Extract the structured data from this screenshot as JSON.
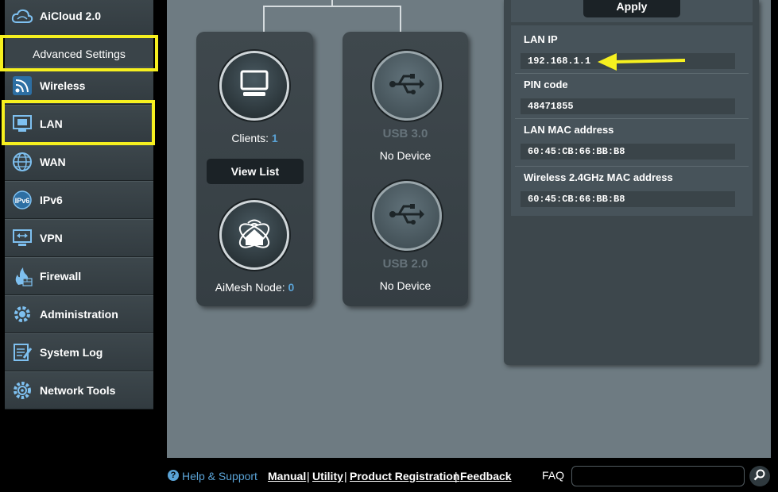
{
  "sidebar": {
    "aicloud_label": "AiCloud 2.0",
    "advanced_header": "Advanced Settings",
    "items": [
      {
        "label": "Wireless",
        "icon": "wireless-icon"
      },
      {
        "label": "LAN",
        "icon": "lan-icon"
      },
      {
        "label": "WAN",
        "icon": "globe-icon"
      },
      {
        "label": "IPv6",
        "icon": "ipv6-icon"
      },
      {
        "label": "VPN",
        "icon": "vpn-icon"
      },
      {
        "label": "Firewall",
        "icon": "firewall-icon"
      },
      {
        "label": "Administration",
        "icon": "administration-gear-icon"
      },
      {
        "label": "System Log",
        "icon": "system-log-icon"
      },
      {
        "label": "Network Tools",
        "icon": "network-tools-icon"
      }
    ]
  },
  "clients_panel": {
    "clients_label": "Clients:",
    "clients_count": "1",
    "view_list_label": "View List",
    "aimesh_label": "AiMesh Node:",
    "aimesh_count": "0"
  },
  "usb_panel": {
    "usb3_label": "USB 3.0",
    "usb3_status": "No Device",
    "usb2_label": "USB 2.0",
    "usb2_status": "No Device"
  },
  "info_panel": {
    "apply_label": "Apply",
    "lan_ip_label": "LAN IP",
    "lan_ip_value": "192.168.1.1",
    "pin_label": "PIN code",
    "pin_value": "48471855",
    "lan_mac_label": "LAN MAC address",
    "lan_mac_value": "60:45:CB:66:BB:B8",
    "wireless_mac_label": "Wireless 2.4GHz MAC address",
    "wireless_mac_value": "60:45:CB:66:BB:B8"
  },
  "footer": {
    "help_label": "Help & Support",
    "manual_label": "Manual",
    "utility_label": "Utility",
    "product_reg_label": "Product Registration",
    "feedback_label": "Feedback",
    "sep": "|",
    "faq_label": "FAQ"
  },
  "colors": {
    "highlight": "#f6f01f",
    "accent_blue": "#5aa3d6",
    "arrow": "#f6f01f"
  }
}
